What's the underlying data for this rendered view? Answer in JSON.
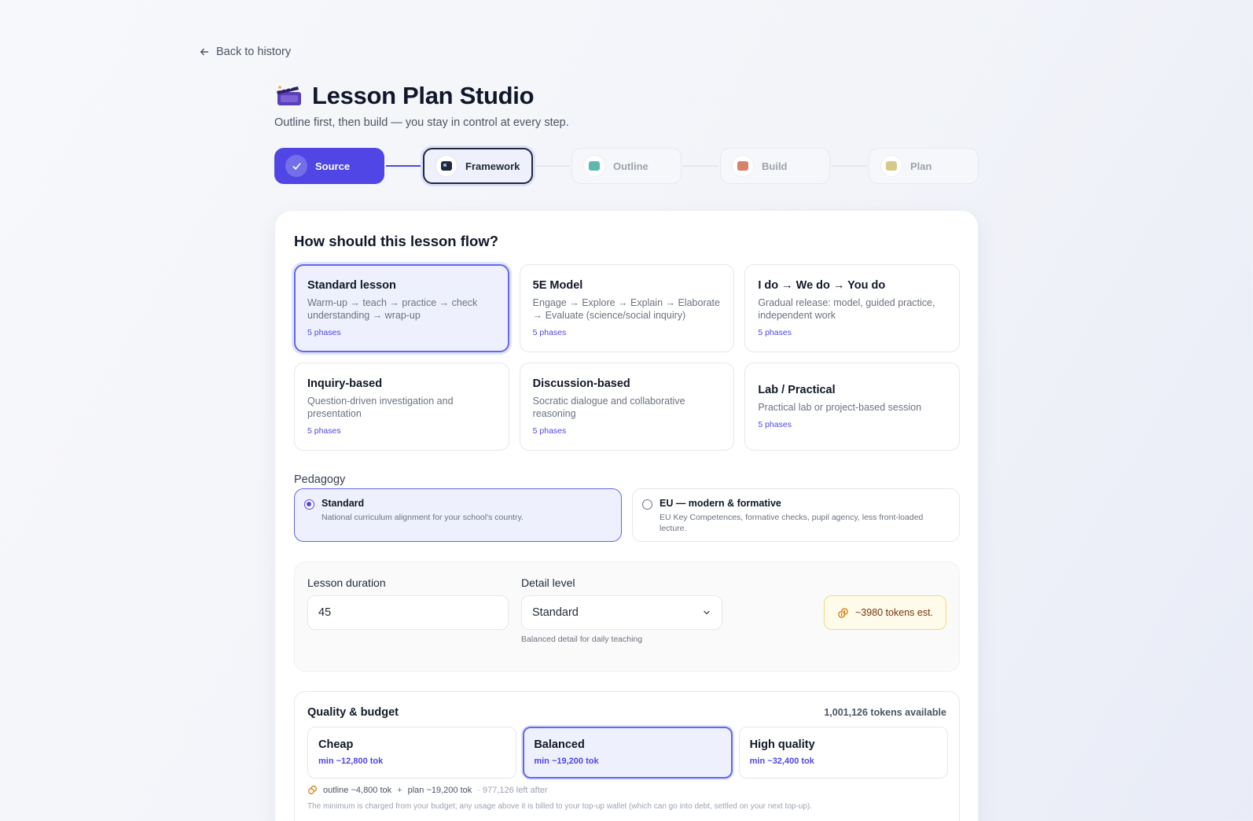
{
  "back": {
    "label": "Back to history",
    "icon": "arrow-left-icon"
  },
  "header": {
    "icon": "lesson-clapper-icon",
    "title": "Lesson Plan Studio",
    "subtitle": "Outline first, then build — you stay in control at every step."
  },
  "stepper": {
    "steps": [
      {
        "label": "Source",
        "state": "done",
        "icon": "check-icon"
      },
      {
        "label": "Framework",
        "state": "active",
        "icon": "framework-icon"
      },
      {
        "label": "Outline",
        "state": "pending",
        "icon": "outline-icon"
      },
      {
        "label": "Build",
        "state": "pending",
        "icon": "build-icon"
      },
      {
        "label": "Plan",
        "state": "pending",
        "icon": "plan-icon"
      }
    ]
  },
  "flow": {
    "question": "How should this lesson flow?",
    "frameworks": [
      {
        "title": "Standard lesson",
        "desc": "Warm-up → teach → practice → check understanding → wrap-up",
        "phases": "5 phases",
        "selected": true
      },
      {
        "title": "5E Model",
        "desc": "Engage → Explore → Explain → Elaborate → Evaluate (science/social inquiry)",
        "phases": "5 phases",
        "selected": false
      },
      {
        "title": "I do → We do → You do",
        "desc": "Gradual release: model, guided practice, independent work",
        "phases": "5 phases",
        "selected": false
      },
      {
        "title": "Inquiry-based",
        "desc": "Question-driven investigation and presentation",
        "phases": "5 phases",
        "selected": false
      },
      {
        "title": "Discussion-based",
        "desc": "Socratic dialogue and collaborative reasoning",
        "phases": "5 phases",
        "selected": false
      },
      {
        "title": "Lab / Practical",
        "desc": "Practical lab or project-based session",
        "phases": "5 phases",
        "selected": false
      }
    ]
  },
  "pedagogy": {
    "label": "Pedagogy",
    "options": [
      {
        "title": "Standard",
        "desc": "National curriculum alignment for your school's country.",
        "selected": true
      },
      {
        "title": "EU — modern & formative",
        "desc": "EU Key Competences, formative checks, pupil agency, less front-loaded lecture.",
        "selected": false
      }
    ]
  },
  "settings": {
    "duration_label": "Lesson duration",
    "duration_value": "45",
    "detail_label": "Detail level",
    "detail_value": "Standard",
    "detail_hint": "Balanced detail for daily teaching",
    "tokens_est": "~3980 tokens est."
  },
  "quality": {
    "title": "Quality & budget",
    "available": "1,001,126 tokens available",
    "options": [
      {
        "title": "Cheap",
        "min": "min ~12,800 tok",
        "selected": false
      },
      {
        "title": "Balanced",
        "min": "min ~19,200 tok",
        "selected": true
      },
      {
        "title": "High quality",
        "min": "min ~32,400 tok",
        "selected": false
      }
    ],
    "outline": "outline ~4,800 tok",
    "plus": "+",
    "plan": "plan ~19,200 tok",
    "left_after": "· 977,126 left after",
    "note": "The minimum is charged from your budget; any usage above it is billed to your top-up wallet (which can go into debt, settled on your next top-up)."
  },
  "colors": {
    "accent": "#4f46e5",
    "selected_bg": "#eef1fd",
    "token_bg": "#fefbea"
  }
}
